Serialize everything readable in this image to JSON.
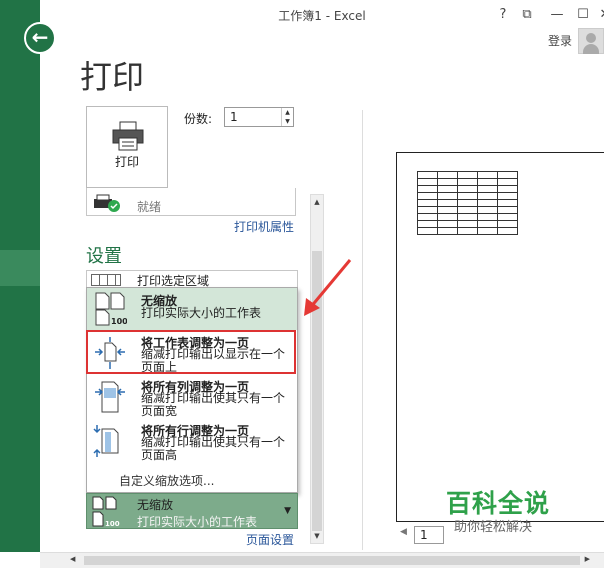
{
  "window": {
    "title": "工作簿1 - Excel",
    "help": "?",
    "signin": "登录"
  },
  "backstage": {
    "page_title": "打印",
    "print_button_label": "打印",
    "copies_label": "份数:",
    "copies_value": "1",
    "printer_status": "就绪",
    "printer_properties": "打印机属性",
    "settings_title": "设置",
    "print_what": "打印选定区域",
    "scaling_options": [
      {
        "title": "无缩放",
        "desc": "打印实际大小的工作表"
      },
      {
        "title": "将工作表调整为一页",
        "desc": "缩减打印输出以显示在一个页面上"
      },
      {
        "title": "将所有列调整为一页",
        "desc": "缩减打印输出使其只有一个页面宽"
      },
      {
        "title": "将所有行调整为一页",
        "desc": "缩减打印输出使其只有一个页面高"
      }
    ],
    "custom_scaling": "自定义缩放选项...",
    "current_scaling": {
      "title": "无缩放",
      "desc": "打印实际大小的工作表"
    },
    "page_setup": "页面设置",
    "page_number": "1"
  },
  "watermark": {
    "brand": "百科全说",
    "slogan": "助你轻松解决"
  },
  "colors": {
    "excel_green": "#217346",
    "highlight_red": "#d33333",
    "selected_option": "#d3e6d8"
  }
}
